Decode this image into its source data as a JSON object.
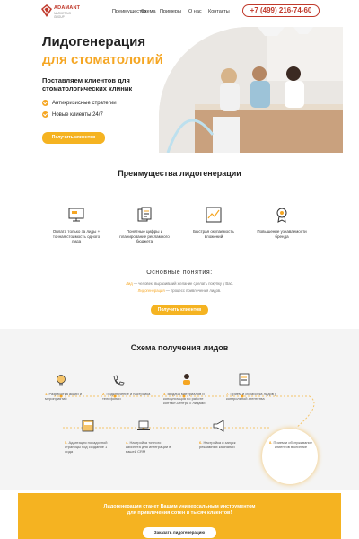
{
  "header": {
    "logo_name": "ADAMANT",
    "logo_sub": "MARKETING GROUP",
    "nav": [
      "Преимущества",
      "Схема",
      "Примеры",
      "О нас",
      "Контакты"
    ],
    "phone": "+7 (499) 216-74-60"
  },
  "hero": {
    "title_line1": "Лидогенерация",
    "title_line2": "для стоматологий",
    "subtitle": "Поставляем клиентов для стоматологических клиник",
    "bullets": [
      "Антикризисные стратегии",
      "Новые клиенты 24/7"
    ],
    "button": "Получить клиентов"
  },
  "advantages": {
    "title": "Преимущества лидогенерации",
    "items": [
      {
        "icon": "monitor-icon",
        "text": "Оплата только за лиды + точная стоимость одного лида"
      },
      {
        "icon": "documents-icon",
        "text": "Понятные цифры и планирование рекламного бюджета"
      },
      {
        "icon": "chart-icon",
        "text": "Быстрая окупаемость вложений"
      },
      {
        "icon": "badge-icon",
        "text": "Повышение узнаваемости бренда"
      }
    ]
  },
  "concepts": {
    "title": "Основные понятия:",
    "line1_term": "Лид",
    "line1_rest": " — человек, выразивший желание сделать покупку у Вас.",
    "line2_term": "Лидогенерация",
    "line2_rest": " — процесс привлечения лидов.",
    "button": "Получить клиентов"
  },
  "scheme": {
    "title": "Схема получения лидов",
    "steps": [
      {
        "num": "1.",
        "text": "Разработка акций и мероприятий",
        "icon": "lightbulb-icon"
      },
      {
        "num": "2.",
        "text": "Подключение и настройка телефонии",
        "icon": "phone-icon"
      },
      {
        "num": "3.",
        "text": "Выдача материалов и консультация по работе контакт-центра с лидами",
        "icon": "operator-icon"
      },
      {
        "num": "7.",
        "text": "Прием и обработка лидов у контрольной агентства",
        "icon": "clipboard-icon"
      },
      {
        "num": "5.",
        "text": "Адаптация посадочной страницы под создание 1 лида",
        "icon": "calculator-icon"
      },
      {
        "num": "4.",
        "text": "Настройка точного кабинета для интеграции в вашей CRM",
        "icon": "laptop-icon"
      },
      {
        "num": "6.",
        "text": "Настройка и запуск рекламных кампаний",
        "icon": "megaphone-icon"
      }
    ],
    "final_num": "8.",
    "final_text": "Прием и обслуживание клиентов в клинике"
  },
  "cta": {
    "line1": "Лидогенерация станет Вашим универсальным инструментом",
    "line2": "для привлечения сотен и тысяч клиентов!",
    "button": "Заказать лидогенерацию"
  },
  "colors": {
    "accent": "#f5b321",
    "brand": "#c0392b"
  }
}
